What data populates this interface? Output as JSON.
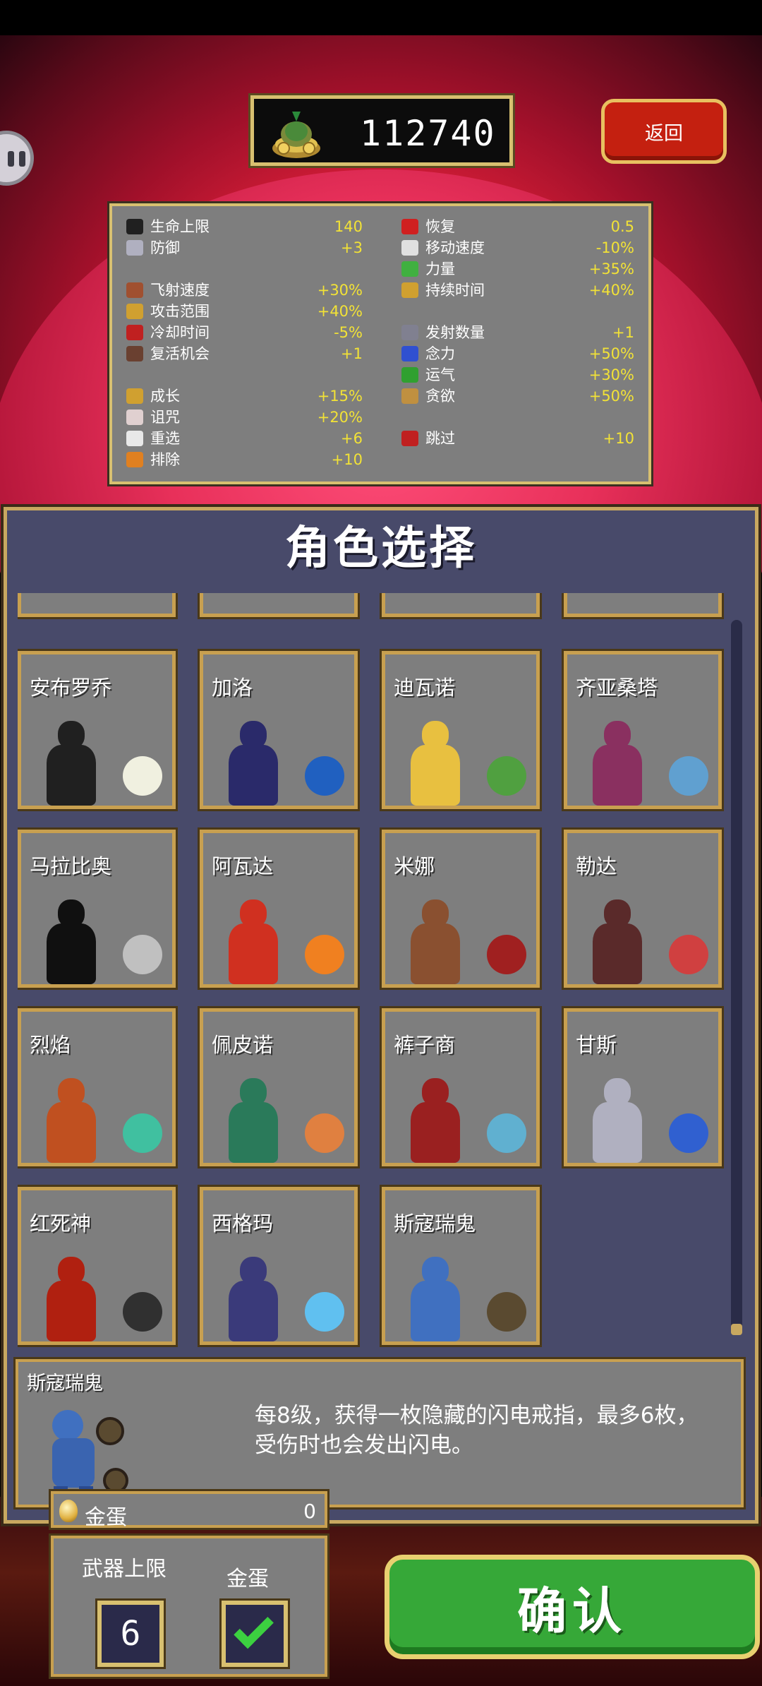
{
  "coins": {
    "value": "112740",
    "icon": "coin-bag-icon"
  },
  "back_button": {
    "label": "返回"
  },
  "pause_button": {
    "icon": "pause-icon"
  },
  "stats": [
    {
      "name": "生命上限",
      "value": "140",
      "icon": "heart-icon",
      "color": "#202020"
    },
    {
      "name": "防御",
      "value": "+3",
      "icon": "armor-icon",
      "color": "#b0b0c0"
    },
    {
      "name": "飞射速度",
      "value": "+30%",
      "icon": "boot-icon",
      "color": "#a05030"
    },
    {
      "name": "攻击范围",
      "value": "+40%",
      "icon": "candelabra-icon",
      "color": "#d0a030"
    },
    {
      "name": "冷却时间",
      "value": "-5%",
      "icon": "clock-icon",
      "color": "#c02020"
    },
    {
      "name": "复活机会",
      "value": "+1",
      "icon": "tiragisu-icon",
      "color": "#6a4030"
    },
    {
      "name": "成长",
      "value": "+15%",
      "icon": "crown-icon",
      "color": "#d0a030"
    },
    {
      "name": "诅咒",
      "value": "+20%",
      "icon": "skull-icon",
      "color": "#e0d0d0"
    },
    {
      "name": "重选",
      "value": "+6",
      "icon": "dice-icon",
      "color": "#e8e8e8"
    },
    {
      "name": "排除",
      "value": "+10",
      "icon": "banish-icon",
      "color": "#e08020"
    },
    {
      "name": "恢复",
      "value": "0.5",
      "icon": "recovery-heart-icon",
      "color": "#d02020"
    },
    {
      "name": "移动速度",
      "value": "-10%",
      "icon": "wing-icon",
      "color": "#e0e0e0"
    },
    {
      "name": "力量",
      "value": "+35%",
      "icon": "spinach-icon",
      "color": "#40b040"
    },
    {
      "name": "持续时间",
      "value": "+40%",
      "icon": "spellbinder-icon",
      "color": "#d0a030"
    },
    {
      "name": "发射数量",
      "value": "+1",
      "icon": "duplicator-icon",
      "color": "#808090"
    },
    {
      "name": "念力",
      "value": "+50%",
      "icon": "orb-icon",
      "color": "#3050d0"
    },
    {
      "name": "运气",
      "value": "+30%",
      "icon": "clover-icon",
      "color": "#30a030"
    },
    {
      "name": "贪欲",
      "value": "+50%",
      "icon": "greed-icon",
      "color": "#c09040"
    },
    {
      "name": "跳过",
      "value": "+10",
      "icon": "skip-icon",
      "color": "#c02020"
    }
  ],
  "title": "角色选择",
  "characters": [
    {
      "name": "安布罗乔",
      "icon": "ambrojoe-icon",
      "figure_color": "#202020",
      "item_color": "#f0f0e0",
      "item_icon": "egg-icon"
    },
    {
      "name": "加洛",
      "icon": "gallo-icon",
      "figure_color": "#2a2a6a",
      "item_color": "#2060c0",
      "item_icon": "wand-icon"
    },
    {
      "name": "迪瓦诺",
      "icon": "divano-icon",
      "figure_color": "#e8c040",
      "item_color": "#50a040",
      "item_icon": "leaf-icon"
    },
    {
      "name": "齐亚桑塔",
      "icon": "zi-assunta-icon",
      "figure_color": "#8a3060",
      "item_color": "#60a0d0",
      "item_icon": "shell-icon"
    },
    {
      "name": "马拉比奥",
      "icon": "mabba-icon",
      "figure_color": "#101010",
      "item_color": "#c0c0c0",
      "item_icon": "knives-icon"
    },
    {
      "name": "阿瓦达",
      "icon": "avatar-icon",
      "figure_color": "#d03020",
      "item_color": "#f08020",
      "item_icon": "fire-icon"
    },
    {
      "name": "米娜",
      "icon": "minnah-icon",
      "figure_color": "#8a5030",
      "item_color": "#a02020",
      "item_icon": "whip-icon"
    },
    {
      "name": "勒达",
      "icon": "leda-icon",
      "figure_color": "#5a2a2a",
      "item_color": "#d04040",
      "item_icon": "feather-icon"
    },
    {
      "name": "烈焰",
      "icon": "peppino-bird-icon",
      "figure_color": "#c05020",
      "item_color": "#40c0a0",
      "item_icon": "spark-icon"
    },
    {
      "name": "佩皮诺",
      "icon": "christmas-tree-icon",
      "figure_color": "#2a7a5a",
      "item_color": "#e08040",
      "item_icon": "ornament-icon"
    },
    {
      "name": "裤子商",
      "icon": "pantalone-icon",
      "figure_color": "#9a2020",
      "item_color": "#60b0d0",
      "item_icon": "gift-icon"
    },
    {
      "name": "甘斯",
      "icon": "gyorunton-icon",
      "figure_color": "#b0b0c0",
      "item_color": "#3060d0",
      "item_icon": "bone-icon"
    },
    {
      "name": "红死神",
      "icon": "red-death-icon",
      "figure_color": "#b02010",
      "item_color": "#303030",
      "item_icon": "scythe-icon"
    },
    {
      "name": "西格玛",
      "icon": "sigma-icon",
      "figure_color": "#3a3a7a",
      "item_color": "#60c0f0",
      "item_icon": "ice-icon"
    },
    {
      "name": "斯寇瑞鬼",
      "icon": "scorej-oni-icon",
      "figure_color": "#4070c0",
      "item_color": "#5a4a30",
      "item_icon": "drum-icon"
    }
  ],
  "selected": {
    "name": "斯寇瑞鬼",
    "description": "每8级，获得一枚隐藏的闪电戒指，最多6枚，受伤时也会发出闪电。"
  },
  "golden_egg": {
    "label": "金蛋",
    "count": "0"
  },
  "options": {
    "weapon_limit_label": "武器上限",
    "weapon_limit_value": "6",
    "golden_egg_label": "金蛋",
    "golden_egg_checked": true
  },
  "confirm_button": {
    "label": "确认"
  }
}
